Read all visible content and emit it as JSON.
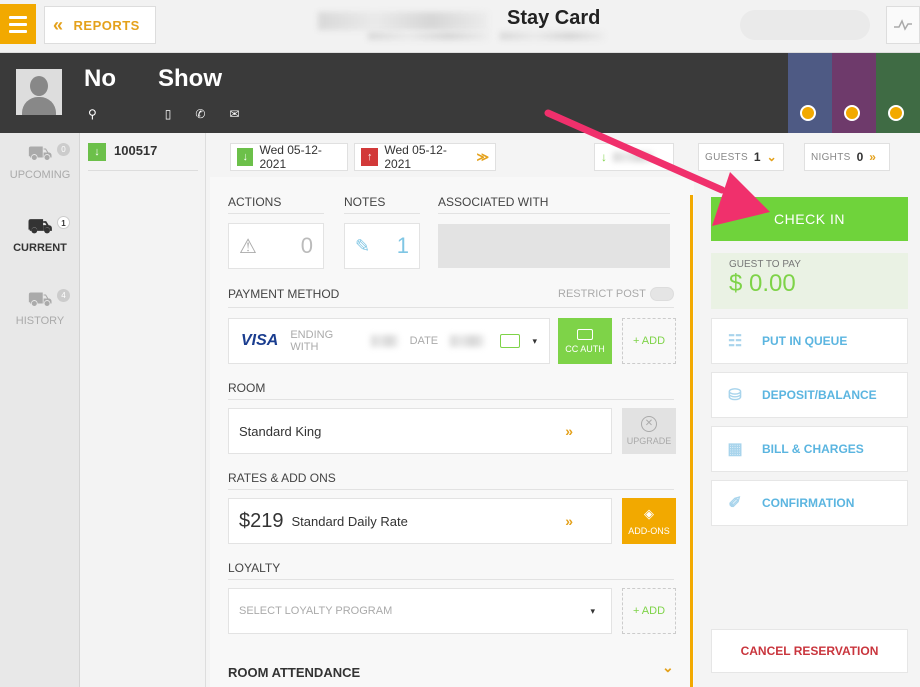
{
  "header": {
    "reports_label": "REPORTS",
    "title": "Stay Card"
  },
  "guest": {
    "first_name": "No",
    "last_name": "Show",
    "contact_icons": [
      "location-icon",
      "mobile-icon",
      "phone-icon",
      "email-icon"
    ]
  },
  "leftnav": [
    {
      "label": "UPCOMING",
      "count": "0"
    },
    {
      "label": "CURRENT",
      "count": "1"
    },
    {
      "label": "HISTORY",
      "count": "4"
    }
  ],
  "reservation_number": "100517",
  "dates": {
    "arrival": "Wed 05-12-2021",
    "departure": "Wed 05-12-2021"
  },
  "stay_info": {
    "guests_label": "GUESTS",
    "guests_value": "1",
    "nights_label": "NIGHTS",
    "nights_value": "0"
  },
  "sections": {
    "actions_label": "ACTIONS",
    "actions_count": "0",
    "notes_label": "NOTES",
    "notes_count": "1",
    "associated_label": "ASSOCIATED WITH",
    "payment_label": "PAYMENT METHOD",
    "restrict_post_label": "RESTRICT POST",
    "room_label": "ROOM",
    "rates_label": "RATES & ADD ONS",
    "loyalty_label": "LOYALTY",
    "attendance_label": "ROOM ATTENDANCE"
  },
  "payment": {
    "card_brand": "VISA",
    "ending_label": "ENDING WITH",
    "date_label": "DATE",
    "cc_auth_label": "CC AUTH",
    "add_label": "+ ADD"
  },
  "room": {
    "type": "Standard King",
    "upgrade_label": "UPGRADE"
  },
  "rate": {
    "amount": "$219",
    "name": "Standard Daily Rate",
    "addons_label": "ADD-ONS"
  },
  "loyalty": {
    "placeholder": "SELECT LOYALTY PROGRAM",
    "add_label": "+ ADD"
  },
  "right_panel": {
    "check_in_label": "CHECK IN",
    "guest_to_pay_label": "GUEST TO PAY",
    "guest_to_pay_amount": "$ 0.00",
    "put_in_queue_label": "PUT IN QUEUE",
    "deposit_label": "DEPOSIT/BALANCE",
    "bill_label": "BILL & CHARGES",
    "confirmation_label": "CONFIRMATION",
    "cancel_label": "CANCEL RESERVATION"
  },
  "colors": {
    "accent": "#f2a900",
    "success": "#6fd33b",
    "link": "#5bb5e0",
    "danger": "#c9353d",
    "annotation_arrow": "#f0306c"
  }
}
